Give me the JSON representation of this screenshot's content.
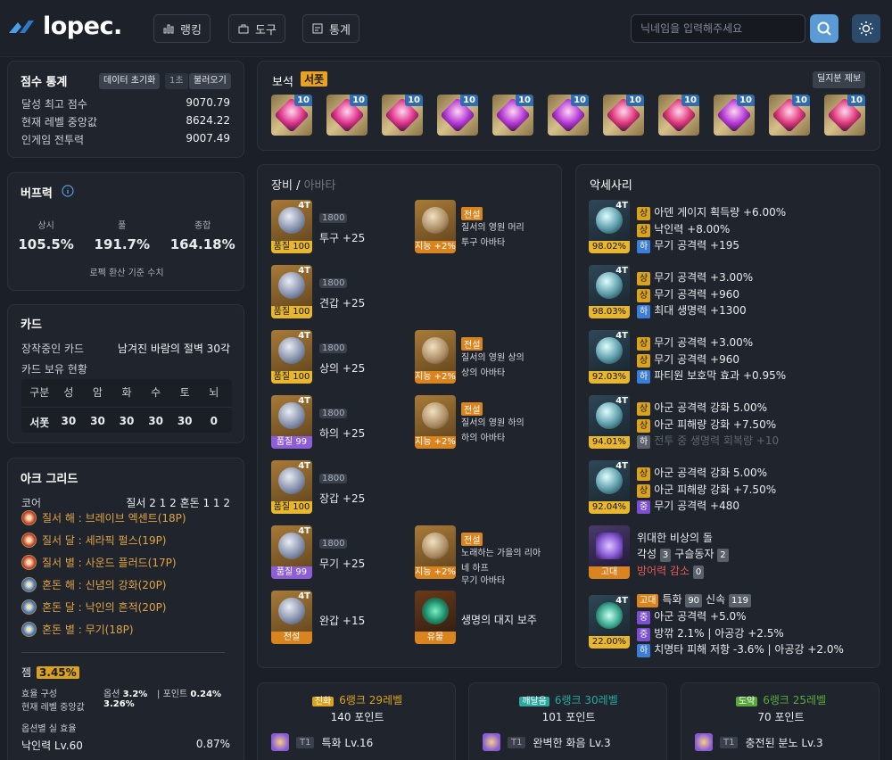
{
  "header": {
    "logo_text": "lopec.",
    "nav": [
      {
        "label": "랭킹",
        "icon": "ranking-icon"
      },
      {
        "label": "도구",
        "icon": "tool-icon"
      },
      {
        "label": "통계",
        "icon": "stats-icon"
      }
    ],
    "search_placeholder": "닉네임을 입력해주세요"
  },
  "score": {
    "title": "점수 통계",
    "btn_reset": "데이터 초기화",
    "btn_sec": "1초",
    "btn_load": "불러오기",
    "rows": [
      {
        "label": "달성 최고 점수",
        "value": "9070.79"
      },
      {
        "label": "현재 레벨 중앙값",
        "value": "8624.22"
      },
      {
        "label": "인게임 전투력",
        "value": "9007.49"
      }
    ]
  },
  "buff": {
    "title": "버프력",
    "cols": [
      {
        "label": "상시",
        "value": "105.5%"
      },
      {
        "label": "풀",
        "value": "191.7%"
      },
      {
        "label": "종합",
        "value": "164.18%"
      }
    ],
    "note": "로펙 환산 기준 수치"
  },
  "card": {
    "title": "카드",
    "equipped_label": "장착중인 카드",
    "equipped_value": "남겨진 바람의 절벽 30각",
    "owned_label": "카드 보유 현황",
    "headers": [
      "구분",
      "성",
      "암",
      "화",
      "수",
      "토",
      "뇌"
    ],
    "row": [
      "서폿",
      "30",
      "30",
      "30",
      "30",
      "30",
      "0"
    ]
  },
  "arkgrid": {
    "title": "아크 그리드",
    "core_label": "코어",
    "core_value": "질서 2 1 2 혼돈 1 1 2",
    "items": [
      {
        "text": "질서 해 : 브레이브 엑센트(18P)",
        "color": "#c9402f"
      },
      {
        "text": "질서 달 : 세라픽 펄스(19P)",
        "color": "#c9402f"
      },
      {
        "text": "질서 별 : 사운드 플러드(17P)",
        "color": "#c9402f"
      },
      {
        "text": "혼돈 해 : 신념의 강화(20P)",
        "color": "#3a78c9"
      },
      {
        "text": "혼돈 달 : 낙인의 흔적(20P)",
        "color": "#3a78c9"
      },
      {
        "text": "혼돈 별 : 무기(18P)",
        "color": "#3a78c9"
      }
    ],
    "gem_label": "젬",
    "gem_value": "3.45%",
    "eff_label": "효율 구성",
    "opt_label": "옵션",
    "opt_value": "3.2%",
    "point_label": "포인트",
    "point_value": "0.24%",
    "median_label": "현재 레벨 중앙값",
    "median_value": "3.26%",
    "real_label": "옵션별 실 효율",
    "real_name": "낙인력 Lv.60",
    "real_value": "0.87%"
  },
  "gems": {
    "title": "보석",
    "tag": "서폿",
    "report_btn": "딜지분 제보",
    "levels": [
      "10",
      "10",
      "10",
      "10",
      "10",
      "10",
      "10",
      "10",
      "10",
      "10",
      "10"
    ],
    "colors": [
      "#e0348a",
      "#e0348a",
      "#e0348a",
      "#b63ad8",
      "#b63ad8",
      "#b63ad8",
      "#e03a7a",
      "#e03a7a",
      "#b63ad8",
      "#e03a7a",
      "#e03a7a"
    ]
  },
  "equip": {
    "title": "장비",
    "title_sep": "/",
    "title_sub": "아바타",
    "items": [
      {
        "tier": "4T",
        "quality": "품질 100",
        "q": "q100",
        "ilv": "1800",
        "name": "투구 +25"
      },
      {
        "tier": "4T",
        "quality": "품질 100",
        "q": "q100",
        "ilv": "1800",
        "name": "견갑 +25"
      },
      {
        "tier": "4T",
        "quality": "품질 100",
        "q": "q100",
        "ilv": "1800",
        "name": "상의 +25"
      },
      {
        "tier": "4T",
        "quality": "품질 99",
        "q": "q99",
        "ilv": "1800",
        "name": "하의 +25"
      },
      {
        "tier": "4T",
        "quality": "품질 100",
        "q": "q100",
        "ilv": "1800",
        "name": "장갑 +25"
      },
      {
        "tier": "4T",
        "quality": "품질 99",
        "q": "q99",
        "ilv": "1800",
        "name": "무기 +25"
      },
      {
        "tier": "4T",
        "quality": "전설",
        "q": "qleg",
        "ilv": "",
        "name": "완갑 +15"
      }
    ],
    "avatars": [
      {
        "stat": "지능 +2%",
        "grade": "전설",
        "line1": "질서의 영원 머리",
        "line2": "투구 아바타"
      },
      {
        "stat": "지능 +2%",
        "grade": "전설",
        "line1": "질서의 영원 상의",
        "line2": "상의 아바타"
      },
      {
        "stat": "지능 +2%",
        "grade": "전설",
        "line1": "질서의 영원 하의",
        "line2": "하의 아바타"
      },
      {
        "stat": "지능 +2%",
        "grade": "전설",
        "line1": "노래하는 가을의 리아",
        "line2": "네 하프",
        "line3": "무기 아바타"
      }
    ],
    "stone_label": "유물",
    "stone_name": "생명의 대지 보주"
  },
  "accessories": {
    "title": "악세사리",
    "items": [
      {
        "tier": "4T",
        "pct": "98.02%",
        "lines": [
          {
            "g": "상",
            "t": "아덴 게이지 획득량 +6.00%"
          },
          {
            "g": "상",
            "t": "낙인력 +8.00%"
          },
          {
            "g": "하",
            "t": "무기 공격력 +195"
          }
        ]
      },
      {
        "tier": "4T",
        "pct": "98.03%",
        "lines": [
          {
            "g": "상",
            "t": "무기 공격력 +3.00%"
          },
          {
            "g": "상",
            "t": "무기 공격력 +960"
          },
          {
            "g": "하",
            "t": "최대 생명력 +1300"
          }
        ]
      },
      {
        "tier": "4T",
        "pct": "92.03%",
        "lines": [
          {
            "g": "상",
            "t": "무기 공격력 +3.00%"
          },
          {
            "g": "상",
            "t": "무기 공격력 +960"
          },
          {
            "g": "하",
            "t": "파티원 보호막 효과 +0.95%"
          }
        ]
      },
      {
        "tier": "4T",
        "pct": "94.01%",
        "lines": [
          {
            "g": "상",
            "t": "아군 공격력 강화 5.00%"
          },
          {
            "g": "상",
            "t": "아군 피해량 강화 +7.50%"
          },
          {
            "g": "하",
            "t": "전투 중 생명력 회복량 +10"
          }
        ]
      },
      {
        "tier": "4T",
        "pct": "92.04%",
        "lines": [
          {
            "g": "상",
            "t": "아군 공격력 강화 5.00%"
          },
          {
            "g": "상",
            "t": "아군 피해량 강화 +7.50%"
          },
          {
            "g": "중",
            "t": "무기 공격력 +480"
          }
        ]
      }
    ],
    "stone": {
      "name": "위대한 비상의 돌",
      "badge": "고대",
      "l1a": "각성",
      "l1b": "3",
      "l1c": "구슬동자",
      "l1d": "2",
      "l2a": "방어력 감소",
      "l2b": "0"
    },
    "bracelet": {
      "tier": "4T",
      "pct": "22.00%",
      "badge": "고대",
      "s1": "특화",
      "s1v": "90",
      "s2": "신속",
      "s2v": "119",
      "lines": [
        {
          "g": "중",
          "t": "아군 공격력 +5.0%"
        },
        {
          "g": "중",
          "t": "방깎 2.1% | 아공강 +2.5%"
        },
        {
          "g": "하",
          "t": "치명타 피해 저항 -3.6% | 아공강 +2.0%"
        }
      ]
    }
  },
  "ark_passive": [
    {
      "tag": "진화",
      "level": "6랭크 29레벨",
      "points": "140 포인트",
      "tier": "T1",
      "skill": "특화 Lv.16",
      "tagColor": "#d9a21f"
    },
    {
      "tag": "깨달음",
      "level": "6랭크 30레벨",
      "points": "101 포인트",
      "tier": "T1",
      "skill": "완벽한 화음 Lv.3",
      "tagColor": "#2aa8a0"
    },
    {
      "tag": "도약",
      "level": "6랭크 25레벨",
      "points": "70 포인트",
      "tier": "T1",
      "skill": "충전된 분노 Lv.3",
      "tagColor": "#5aa83c"
    }
  ]
}
